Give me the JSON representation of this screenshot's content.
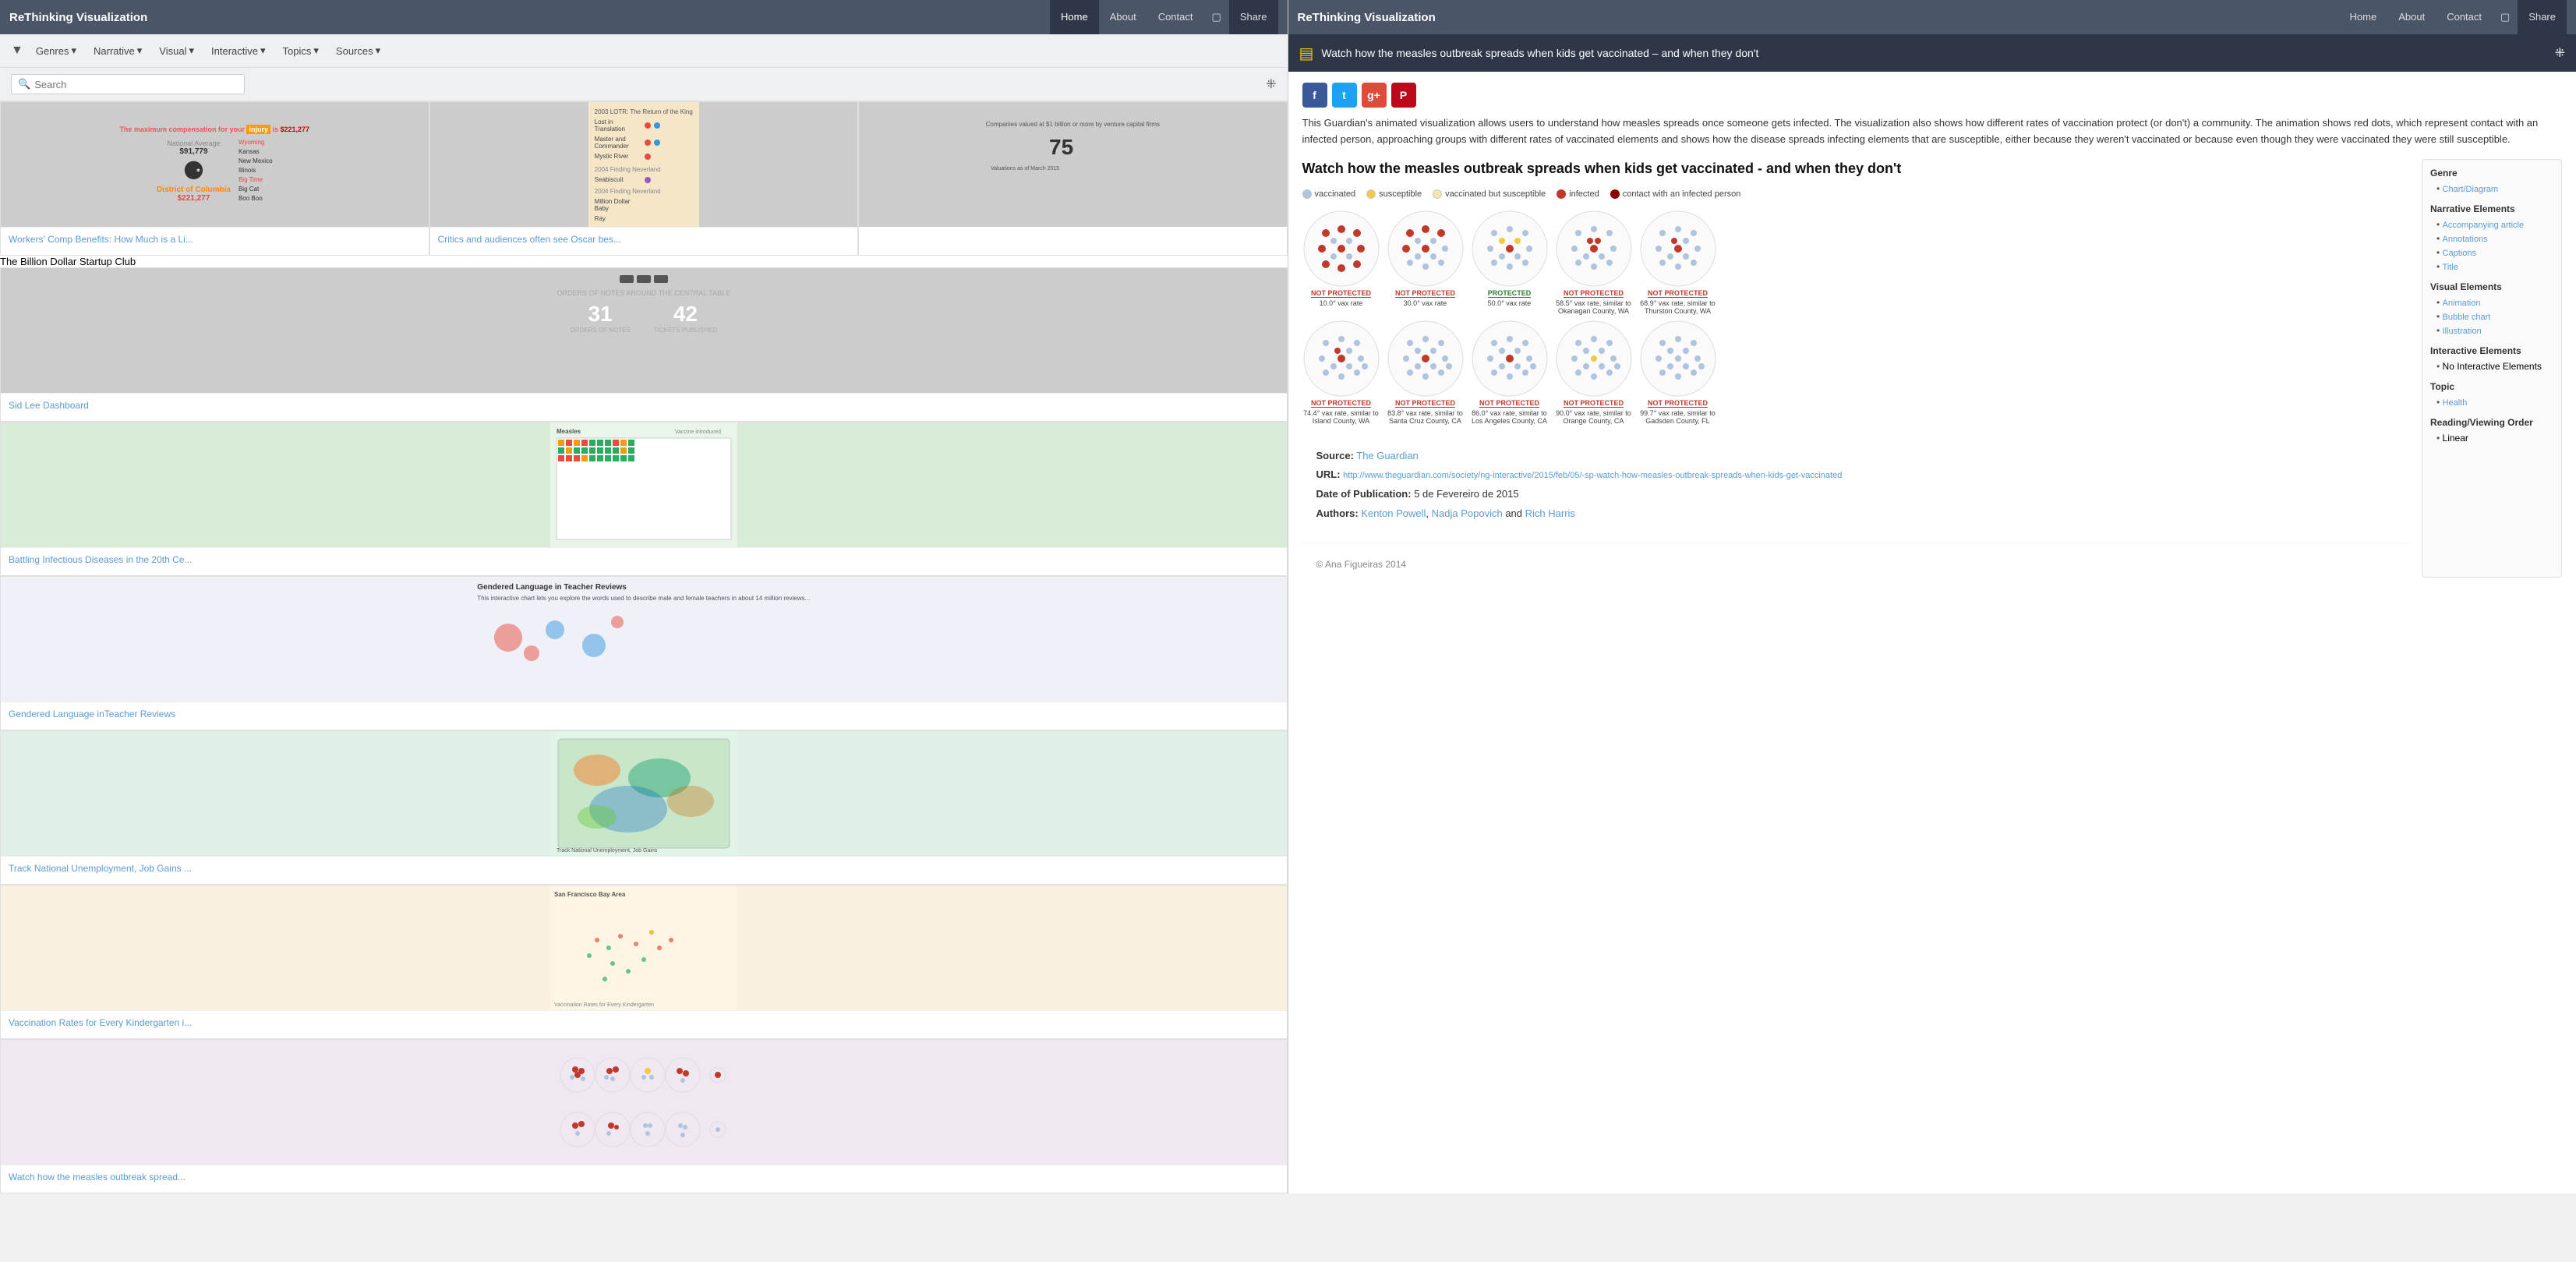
{
  "left": {
    "brand": "ReThinking Visualization",
    "nav": {
      "home": "Home",
      "about": "About",
      "contact": "Contact",
      "share": "Share"
    },
    "filters": {
      "icon": "▼",
      "genres": "Genres",
      "narrative": "Narrative",
      "visual": "Visual",
      "interactive": "Interactive",
      "topics": "Topics",
      "sources": "Sources"
    },
    "search": {
      "placeholder": "Search"
    },
    "grid_items": [
      {
        "id": "workers-comp",
        "label": "Workers' Comp Benefits: How Much is a Li...",
        "thumb_type": "workers"
      },
      {
        "id": "oscar-critics",
        "label": "Critics and audiences often see Oscar bes...",
        "thumb_type": "oscar"
      },
      {
        "id": "startup-club",
        "label": "The Billion Dollar Startup Club",
        "thumb_type": "startup"
      },
      {
        "id": "sid-lee",
        "label": "Sid Lee Dashboard",
        "thumb_type": "sid"
      },
      {
        "id": "battling-diseases",
        "label": "Battling Infectious Diseases in the 20th Ce...",
        "thumb_type": "battling"
      },
      {
        "id": "gendered-language",
        "label": "Gendered Language inTeacher Reviews",
        "thumb_type": "gendered"
      },
      {
        "id": "unemployment",
        "label": "Track National Unemployment, Job Gains ...",
        "thumb_type": "unemployment"
      },
      {
        "id": "vaccination-rates",
        "label": "Vaccination Rates for Every Kindergarten i...",
        "thumb_type": "vaccination"
      },
      {
        "id": "measles-spread",
        "label": "Watch how the measles outbreak spread...",
        "thumb_type": "measles"
      }
    ]
  },
  "right": {
    "brand": "ReThinking Visualization",
    "nav": {
      "home": "Home",
      "about": "About",
      "contact": "Contact",
      "share": "Share"
    },
    "article_header": "Watch how the measles outbreak spreads when kids get vaccinated – and when they don't",
    "social": {
      "facebook": "f",
      "twitter": "t",
      "google": "g+",
      "pinterest": "P"
    },
    "description": "This Guardian's animated visualization allows users to understand how measles spreads once someone gets infected. The visualization also shows how different rates of vaccination protect (or don't) a community. The animation shows red dots, which represent contact with an infected person, approaching groups with different rates of vaccinated elements and shows how the disease spreads infecting elements that are susceptible, either because they weren't vaccinated or because even though they were vaccinated they were still susceptible.",
    "article_title": "Watch how the measles outbreak spreads when kids get vaccinated - and when they don't",
    "legend": [
      {
        "label": "vaccinated",
        "color": "vaccinated"
      },
      {
        "label": "susceptible",
        "color": "susceptible"
      },
      {
        "label": "vaccinated but susceptible",
        "color": "vacc-susc"
      },
      {
        "label": "infected",
        "color": "infected"
      },
      {
        "label": "contact with an infected person",
        "color": "contact"
      }
    ],
    "circles": [
      {
        "status": "NOT PROTECTED",
        "status_type": "not-protected",
        "vax_rate": "10.0° vax rate"
      },
      {
        "status": "NOT PROTECTED",
        "status_type": "not-protected",
        "vax_rate": "30.0° vax rate"
      },
      {
        "status": "PROTECTED",
        "status_type": "protected",
        "vax_rate": "50.0° vax rate"
      },
      {
        "status": "NOT PROTECTED",
        "status_type": "not-protected",
        "vax_rate": "58.5° vax rate, similar to Okanagan County, WA"
      },
      {
        "status": "NOT PROTECTED",
        "status_type": "not-protected",
        "vax_rate": "68.9° vax rate, similar to Thurston County, WA"
      },
      {
        "status": "NOT PROTECTED",
        "status_type": "not-protected",
        "vax_rate": "74.4° vax rate, similar to Island County, WA"
      },
      {
        "status": "NOT PROTECTED",
        "status_type": "not-protected",
        "vax_rate": "83.8° vax rate, similar to Santa Cruz County, CA"
      },
      {
        "status": "NOT PROTECTED",
        "status_type": "not-protected",
        "vax_rate": "86.0° vax rate, similar to Los Angeles County, CA"
      },
      {
        "status": "NOT PROTECTED",
        "status_type": "not-protected",
        "vax_rate": "90.0° vax rate, similar to Orange County, CA"
      },
      {
        "status": "NOT PROTECTED",
        "status_type": "not-protected",
        "vax_rate": "99.7° vax rate, similar to Gadsden County, FL"
      }
    ],
    "source_label": "Source:",
    "source_name": "The Guardian",
    "url_label": "URL:",
    "url_text": "http://www.theguardian.com/society/ng-interactive/2015/feb/05/-sp-watch-how-measles-outbreak-spreads-when-kids-get-vaccinated",
    "date_label": "Date of Publication:",
    "date_value": "5 de Fevereiro de 2015",
    "authors_label": "Authors:",
    "authors": [
      "Kenton Powell",
      "Nadja Popovich",
      "Rich Harris"
    ],
    "sidebar": {
      "genre_title": "Genre",
      "genre_items": [
        "Chart/Diagram"
      ],
      "narrative_title": "Narrative Elements",
      "narrative_items": [
        "Accompanying article",
        "Annotations",
        "Captions",
        "Title"
      ],
      "visual_title": "Visual Elements",
      "visual_items": [
        "Animation",
        "Bubble chart",
        "Illustration"
      ],
      "interactive_title": "Interactive Elements",
      "interactive_items": [
        "No Interactive Elements"
      ],
      "topic_title": "Topic",
      "topic_items": [
        "Health"
      ],
      "reading_title": "Reading/Viewing Order",
      "reading_items": [
        "Linear"
      ]
    },
    "footer": "© Ana Figueiras 2014"
  }
}
